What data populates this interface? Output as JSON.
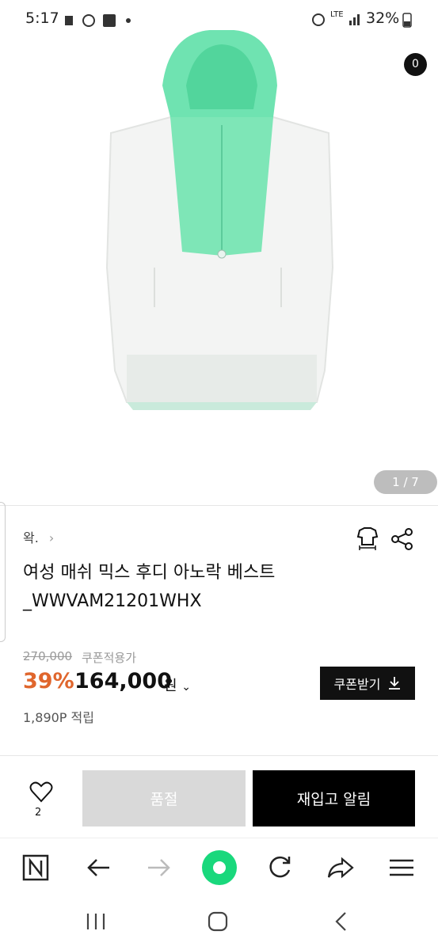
{
  "status_bar": {
    "time": "5:17",
    "network": "LTE",
    "battery": "32%"
  },
  "hero": {
    "counter": "1 / 7",
    "cart_count": "0"
  },
  "product": {
    "brand": "왁.",
    "title_line1": "여성 매쉬 믹스 후디 아노락 베스트",
    "title_line2": "_WWVAM21201WHX",
    "original_price": "270,000",
    "coupon_note": "쿠폰적용가",
    "discount": "39%",
    "price": "164,000",
    "currency": "원",
    "points": "1,890P 적립",
    "coupon_button": "쿠폰받기"
  },
  "actions": {
    "like_count": "2",
    "soldout_label": "품절",
    "restock_label": "재입고 알림"
  },
  "colors": {
    "accent": "#e0662d",
    "hood_green": "#6fe3b1",
    "dark": "#111111"
  }
}
